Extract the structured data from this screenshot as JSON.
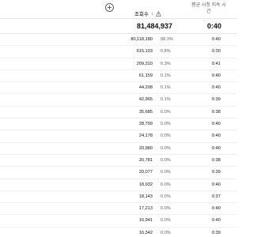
{
  "header": {
    "add_column_icon": "plus-circle-icon",
    "views_label": "조회수",
    "sort_icon": "arrow-down-icon",
    "warning_icon": "warning-triangle-icon",
    "avg_watch_time_label": "평균 시청 지속 시간"
  },
  "total": {
    "views": "81,484,937",
    "avg_watch_time": "0:40"
  },
  "rows": [
    {
      "views": "80,118,180",
      "percent": "98.3%",
      "avg": "0:40"
    },
    {
      "views": "615,103",
      "percent": "0.8%",
      "avg": "0:30"
    },
    {
      "views": "209,310",
      "percent": "0.3%",
      "avg": "0:41"
    },
    {
      "views": "61,159",
      "percent": "0.1%",
      "avg": "0:40"
    },
    {
      "views": "44,208",
      "percent": "0.1%",
      "avg": "0:40"
    },
    {
      "views": "42,965",
      "percent": "0.1%",
      "avg": "0:39"
    },
    {
      "views": "35,685",
      "percent": "0.0%",
      "avg": "0:38"
    },
    {
      "views": "28,799",
      "percent": "0.0%",
      "avg": "0:40"
    },
    {
      "views": "24,178",
      "percent": "0.0%",
      "avg": "0:40"
    },
    {
      "views": "20,980",
      "percent": "0.0%",
      "avg": "0:40"
    },
    {
      "views": "20,781",
      "percent": "0.0%",
      "avg": "0:38"
    },
    {
      "views": "20,077",
      "percent": "0.0%",
      "avg": "0:39"
    },
    {
      "views": "18,932",
      "percent": "0.0%",
      "avg": "0:40"
    },
    {
      "views": "18,143",
      "percent": "0.0%",
      "avg": "0:37"
    },
    {
      "views": "17,213",
      "percent": "0.0%",
      "avg": "0:40"
    },
    {
      "views": "16,941",
      "percent": "0.0%",
      "avg": "0:40"
    },
    {
      "views": "16,342",
      "percent": "0.0%",
      "avg": "0:39"
    }
  ]
}
